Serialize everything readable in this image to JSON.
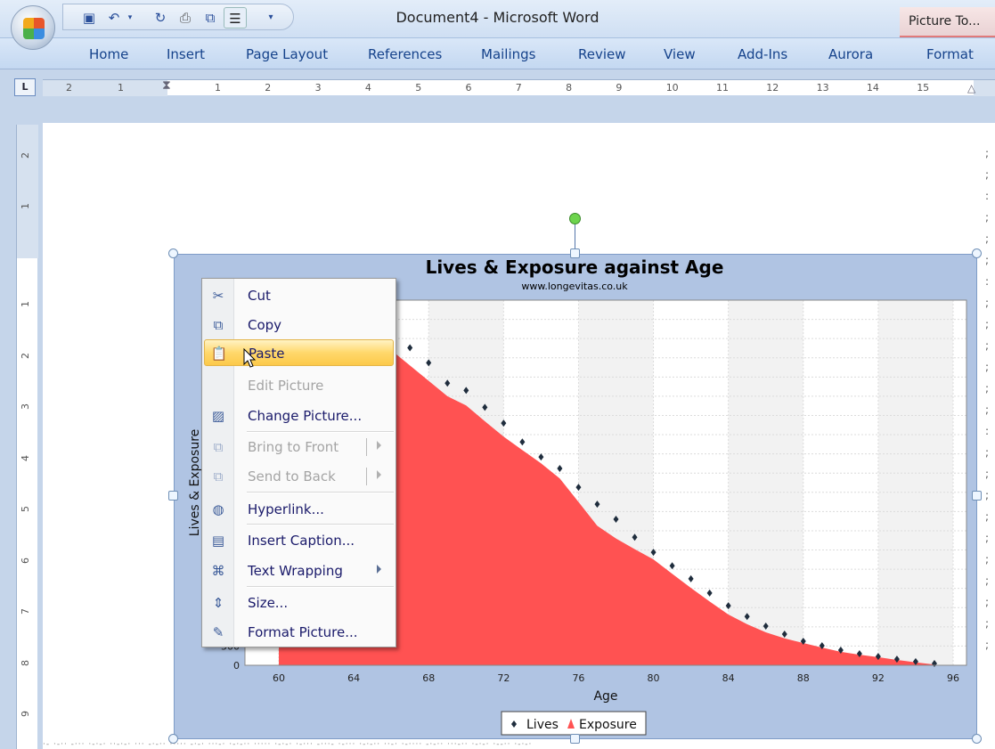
{
  "window": {
    "title": "Document4 - Microsoft Word",
    "contextual_tab": "Picture To..."
  },
  "quick_access": {
    "icons": [
      "save-icon",
      "undo-icon",
      "undo-dropdown-icon",
      "redo-icon",
      "print-preview-icon",
      "paste-special-icon",
      "format-icon",
      "customize-dropdown-icon"
    ]
  },
  "ribbon": {
    "tabs": [
      {
        "label": "Home"
      },
      {
        "label": "Insert"
      },
      {
        "label": "Page Layout"
      },
      {
        "label": "References"
      },
      {
        "label": "Mailings"
      },
      {
        "label": "Review"
      },
      {
        "label": "View"
      },
      {
        "label": "Add-Ins"
      },
      {
        "label": "Aurora"
      },
      {
        "label": "Format"
      }
    ]
  },
  "ruler": {
    "tab_selector": "L",
    "left_numbers": [
      "2",
      "1"
    ],
    "numbers": [
      "1",
      "2",
      "3",
      "4",
      "5",
      "6",
      "7",
      "8",
      "9",
      "10",
      "11",
      "12",
      "13",
      "14",
      "15"
    ],
    "vertical_numbers": [
      "2",
      "1",
      "1",
      "2",
      "3",
      "4",
      "5",
      "6",
      "7",
      "8",
      "9"
    ]
  },
  "context_menu": {
    "items": [
      {
        "label": "Cut",
        "icon": "scissors-icon",
        "enabled": true
      },
      {
        "label": "Copy",
        "icon": "copy-icon",
        "enabled": true
      },
      {
        "label": "Paste",
        "icon": "paste-icon",
        "enabled": true,
        "highlighted": true
      },
      {
        "label": "Edit Picture",
        "icon": "",
        "enabled": false
      },
      {
        "label": "Change Picture...",
        "icon": "change-picture-icon",
        "enabled": true
      },
      {
        "label": "Bring to Front",
        "icon": "bring-to-front-icon",
        "enabled": false,
        "submenu": true
      },
      {
        "label": "Send to Back",
        "icon": "send-to-back-icon",
        "enabled": false,
        "submenu": true
      },
      {
        "label": "Hyperlink...",
        "icon": "hyperlink-globe-icon",
        "enabled": true
      },
      {
        "label": "Insert Caption...",
        "icon": "insert-caption-icon",
        "enabled": true
      },
      {
        "label": "Text Wrapping",
        "icon": "text-wrapping-icon",
        "enabled": true,
        "submenu": true
      },
      {
        "label": "Size...",
        "icon": "size-icon",
        "enabled": true
      },
      {
        "label": "Format Picture...",
        "icon": "format-picture-icon",
        "enabled": true
      }
    ]
  },
  "chart_data": {
    "type": "area",
    "title": "Lives & Exposure against Age",
    "subtitle": "www.longevitas.co.uk",
    "xlabel": "Age",
    "ylabel": "Lives & Exposure",
    "xlim": [
      58,
      96.8
    ],
    "ylim": [
      0,
      9500
    ],
    "x_ticks": [
      60,
      64,
      68,
      72,
      76,
      80,
      84,
      88,
      92,
      96
    ],
    "y_ticks_visible": [
      "0",
      "500"
    ],
    "grid": true,
    "legend_position": "bottom",
    "colors": {
      "lives": "#1f2d3d",
      "exposure": "#ff5252",
      "frame": "#b0c4e3",
      "band": "#f2f2f2"
    },
    "series": [
      {
        "name": "Lives",
        "kind": "scatter",
        "x": [
          67,
          68,
          69,
          70,
          71,
          72,
          73,
          74,
          75,
          76,
          77,
          78,
          79,
          80,
          81,
          82,
          83,
          84,
          85,
          86,
          87,
          88,
          89,
          90,
          91,
          92,
          93,
          94,
          95
        ],
        "values": [
          8260,
          7870,
          7340,
          7150,
          6710,
          6300,
          5810,
          5420,
          5120,
          4630,
          4190,
          3800,
          3330,
          2940,
          2590,
          2250,
          1880,
          1550,
          1270,
          1020,
          810,
          625,
          510,
          395,
          300,
          230,
          160,
          95,
          45
        ]
      },
      {
        "name": "Exposure",
        "kind": "area",
        "x": [
          60,
          61,
          62,
          63,
          64,
          65,
          66,
          67,
          68,
          69,
          70,
          71,
          72,
          73,
          74,
          75,
          76,
          77,
          78,
          79,
          80,
          81,
          82,
          83,
          84,
          85,
          86,
          87,
          88,
          89,
          90,
          91,
          92,
          93,
          94,
          95
        ],
        "values": [
          9300,
          9150,
          9000,
          8800,
          8600,
          8400,
          8200,
          7800,
          7400,
          7000,
          6760,
          6350,
          5950,
          5600,
          5255,
          4860,
          4250,
          3630,
          3300,
          3020,
          2755,
          2380,
          2014,
          1660,
          1320,
          1070,
          856,
          700,
          580,
          460,
          350,
          275,
          210,
          140,
          75,
          20
        ]
      }
    ]
  }
}
